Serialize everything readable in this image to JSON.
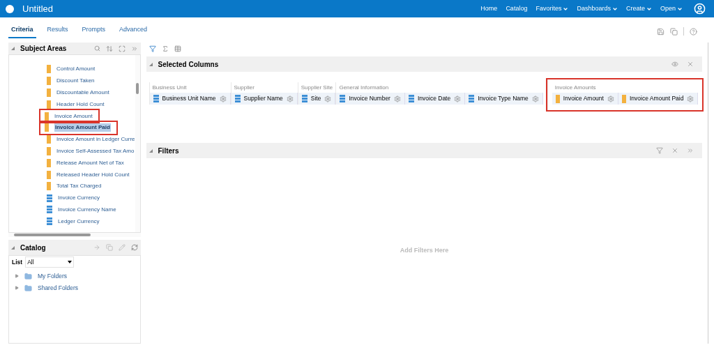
{
  "header": {
    "title": "Untitled",
    "nav": [
      {
        "label": "Home",
        "menu": false
      },
      {
        "label": "Catalog",
        "menu": false
      },
      {
        "label": "Favorites",
        "menu": true
      },
      {
        "label": "Dashboards",
        "menu": true
      },
      {
        "label": "Create",
        "menu": true
      },
      {
        "label": "Open",
        "menu": true
      }
    ]
  },
  "tabs": [
    {
      "label": "Criteria",
      "selected": true
    },
    {
      "label": "Results",
      "selected": false
    },
    {
      "label": "Prompts",
      "selected": false
    },
    {
      "label": "Advanced",
      "selected": false
    }
  ],
  "subject_areas": {
    "title": "Subject Areas",
    "items": [
      {
        "label": "Control Amount",
        "kind": "measure",
        "selected": false,
        "outlined": false
      },
      {
        "label": "Discount Taken",
        "kind": "measure",
        "selected": false,
        "outlined": false
      },
      {
        "label": "Discountable Amount",
        "kind": "measure",
        "selected": false,
        "outlined": false
      },
      {
        "label": "Header Hold Count",
        "kind": "measure",
        "selected": false,
        "outlined": false
      },
      {
        "label": "Invoice Amount",
        "kind": "measure",
        "selected": false,
        "outlined": true
      },
      {
        "label": "Invoice Amount Paid",
        "kind": "measure",
        "selected": true,
        "outlined": true
      },
      {
        "label": "Invoice Amount in Ledger Curre",
        "kind": "measure",
        "selected": false,
        "outlined": false
      },
      {
        "label": "Invoice Self-Assessed Tax Amo",
        "kind": "measure",
        "selected": false,
        "outlined": false
      },
      {
        "label": "Release Amount Net of Tax",
        "kind": "measure",
        "selected": false,
        "outlined": false
      },
      {
        "label": "Released Header Hold Count",
        "kind": "measure",
        "selected": false,
        "outlined": false
      },
      {
        "label": "Total Tax Charged",
        "kind": "measure",
        "selected": false,
        "outlined": false
      },
      {
        "label": "Invoice Currency",
        "kind": "attribute",
        "selected": false,
        "outlined": false
      },
      {
        "label": "Invoice Currency Name",
        "kind": "attribute",
        "selected": false,
        "outlined": false
      },
      {
        "label": "Ledger Currency",
        "kind": "attribute",
        "selected": false,
        "outlined": false
      }
    ]
  },
  "catalog": {
    "title": "Catalog",
    "list_label": "List",
    "list_value": "All",
    "folders": [
      "My Folders",
      "Shared Folders"
    ]
  },
  "selected_columns": {
    "title": "Selected Columns",
    "groups": [
      {
        "title": "Business Unit",
        "outlined": false,
        "columns": [
          {
            "name": "Business Unit Name",
            "kind": "attribute"
          }
        ]
      },
      {
        "title": "Supplier",
        "outlined": false,
        "columns": [
          {
            "name": "Supplier Name",
            "kind": "attribute"
          }
        ]
      },
      {
        "title": "Supplier Site",
        "outlined": false,
        "columns": [
          {
            "name": "Site",
            "kind": "attribute"
          }
        ]
      },
      {
        "title": "General Information",
        "outlined": false,
        "columns": [
          {
            "name": "Invoice Number",
            "kind": "attribute"
          },
          {
            "name": "Invoice Date",
            "kind": "attribute"
          },
          {
            "name": "Invoice Type Name",
            "kind": "attribute"
          }
        ]
      },
      {
        "title": "Invoice Amounts",
        "outlined": true,
        "columns": [
          {
            "name": "Invoice Amount",
            "kind": "measure"
          },
          {
            "name": "Invoice Amount Paid",
            "kind": "measure"
          }
        ]
      }
    ]
  },
  "filters": {
    "title": "Filters",
    "empty_text": "Add Filters Here"
  }
}
